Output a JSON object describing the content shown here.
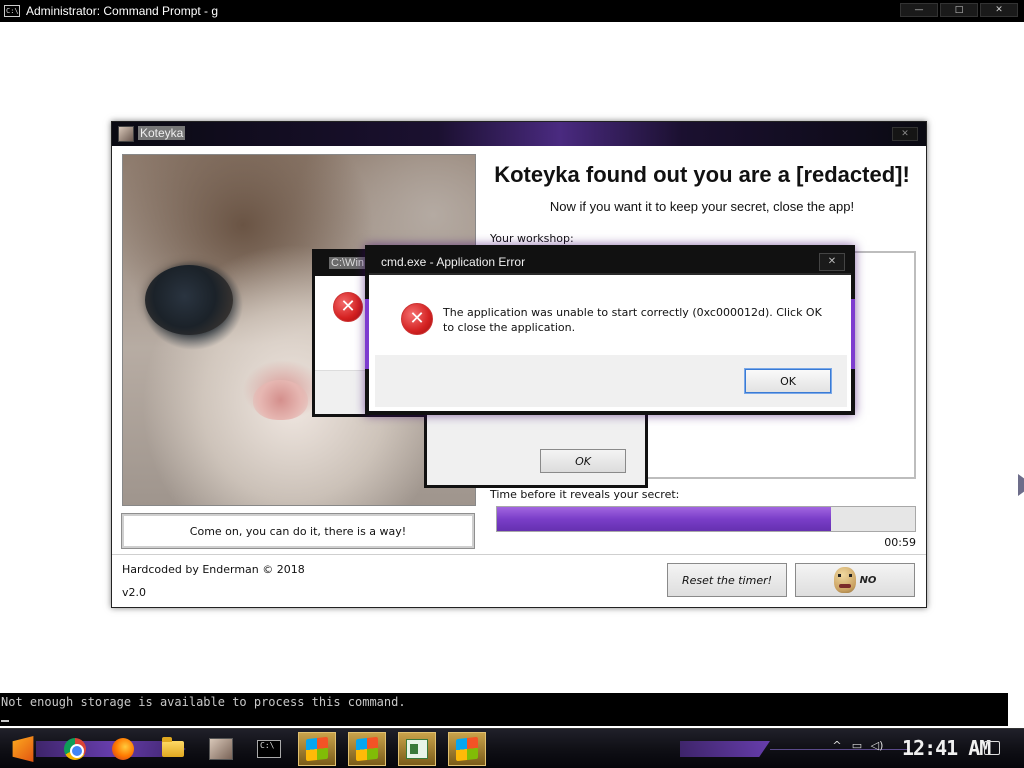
{
  "cmd_window": {
    "title": "Administrator: Command Prompt - g",
    "icon_text": "C:\\",
    "controls": [
      "—",
      "□",
      "✕"
    ]
  },
  "app": {
    "title": "Koteyka",
    "headline": "Koteyka found out you are a [redacted]!",
    "subline": "Now if you want it to keep your secret, close the app!",
    "workshop_label": "Your workshop:",
    "hint_button": "Come on, you can do it, there is a way!",
    "timer_label": "Time before it reveals your secret:",
    "timer_progress": 0.8,
    "timer_value": "00:59",
    "credit": "Hardcoded by Enderman © 2018",
    "version": "v2.0",
    "reset_button": "Reset the timer!",
    "image_button_text": "NO",
    "close_glyph": "✕"
  },
  "error_back": {
    "title": "C:\\Win",
    "icon": "✕"
  },
  "error_mid": {
    "ok_label": "OK"
  },
  "error_front": {
    "title": "cmd.exe - Application Error",
    "message": "The application was unable to start correctly (0xc000012d). Click OK to close the application.",
    "ok_label": "OK",
    "icon": "✕",
    "close_glyph": "✕"
  },
  "console": {
    "message": "Not enough storage is available to process this command."
  },
  "taskbar": {
    "apps": [
      {
        "name": "start",
        "icon": "start-icon"
      },
      {
        "name": "chrome",
        "icon": "chrome-icon"
      },
      {
        "name": "firefox",
        "icon": "firefox-icon"
      },
      {
        "name": "file-explorer",
        "icon": "folder-icon"
      },
      {
        "name": "koteyka",
        "icon": "cat-thumb-icon"
      },
      {
        "name": "command-prompt",
        "icon": "cmd-task-icon"
      },
      {
        "name": "error-app-1",
        "icon": "win-app-icon"
      },
      {
        "name": "error-app-2",
        "icon": "win-app-icon"
      },
      {
        "name": "sheet-app",
        "icon": "sheet-icon"
      },
      {
        "name": "error-app-3",
        "icon": "win-app-icon"
      }
    ],
    "tray_glyphs": {
      "chevron": "^",
      "network": "▭",
      "volume": "◁)"
    },
    "clock": "12:41 AM"
  },
  "colors": {
    "accent_purple": "#7a3ec8",
    "error_red": "#d42222",
    "titlebar_dark": "#111111"
  }
}
